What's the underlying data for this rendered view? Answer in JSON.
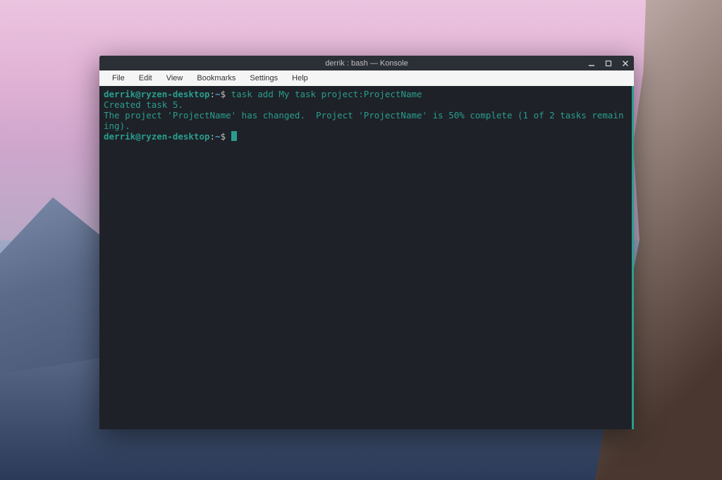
{
  "window": {
    "title": "derrik : bash — Konsole"
  },
  "menubar": {
    "items": [
      "File",
      "Edit",
      "View",
      "Bookmarks",
      "Settings",
      "Help"
    ]
  },
  "terminal": {
    "prompt": {
      "user_host": "derrik@ryzen-desktop",
      "separator": ":",
      "path": "~",
      "symbol": "$"
    },
    "lines": [
      {
        "type": "prompt",
        "command": "task add My task project:ProjectName"
      },
      {
        "type": "output",
        "text": "Created task 5."
      },
      {
        "type": "output",
        "text": "The project 'ProjectName' has changed.  Project 'ProjectName' is 50% complete (1 of 2 tasks remaining)."
      },
      {
        "type": "prompt_cursor"
      }
    ]
  },
  "colors": {
    "terminal_bg": "#1e2127",
    "terminal_accent": "#2a9d8f",
    "terminal_path": "#4a9ecc",
    "menubar_bg": "#f5f5f5",
    "titlebar_bg": "#2b2f36"
  }
}
